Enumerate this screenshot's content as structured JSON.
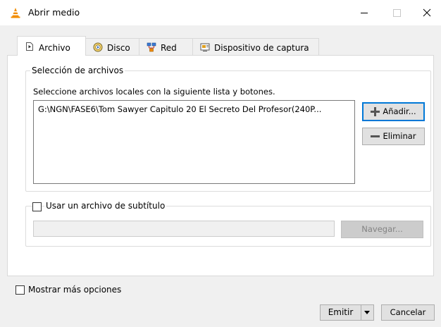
{
  "window": {
    "title": "Abrir medio",
    "controls": {
      "minimize": "minimize-icon",
      "maximize": "maximize-icon",
      "close": "close-icon"
    }
  },
  "tabs": [
    {
      "label": "Archivo",
      "icon": "file-icon",
      "active": true
    },
    {
      "label": "Disco",
      "icon": "disc-icon",
      "active": false
    },
    {
      "label": "Red",
      "icon": "network-icon",
      "active": false
    },
    {
      "label": "Dispositivo de captura",
      "icon": "capture-device-icon",
      "active": false
    }
  ],
  "file_selection": {
    "group_title": "Selección de archivos",
    "hint": "Seleccione archivos locales con la siguiente lista y botones.",
    "files": [
      "G:\\NGN\\FASE6\\Tom Sawyer Capitulo 20 El Secreto Del Profesor(240P..."
    ],
    "add_label": "Añadir...",
    "remove_label": "Eliminar"
  },
  "subtitle": {
    "checkbox_label": "Usar un archivo de subtítulo",
    "checked": false,
    "path_value": "",
    "browse_label": "Navegar..."
  },
  "footer": {
    "more_options_label": "Mostrar más opciones",
    "more_options_checked": false,
    "emit_label": "Emitir",
    "cancel_label": "Cancelar"
  },
  "colors": {
    "focus_border": "#0078d7",
    "vlc_orange": "#f28c00"
  }
}
